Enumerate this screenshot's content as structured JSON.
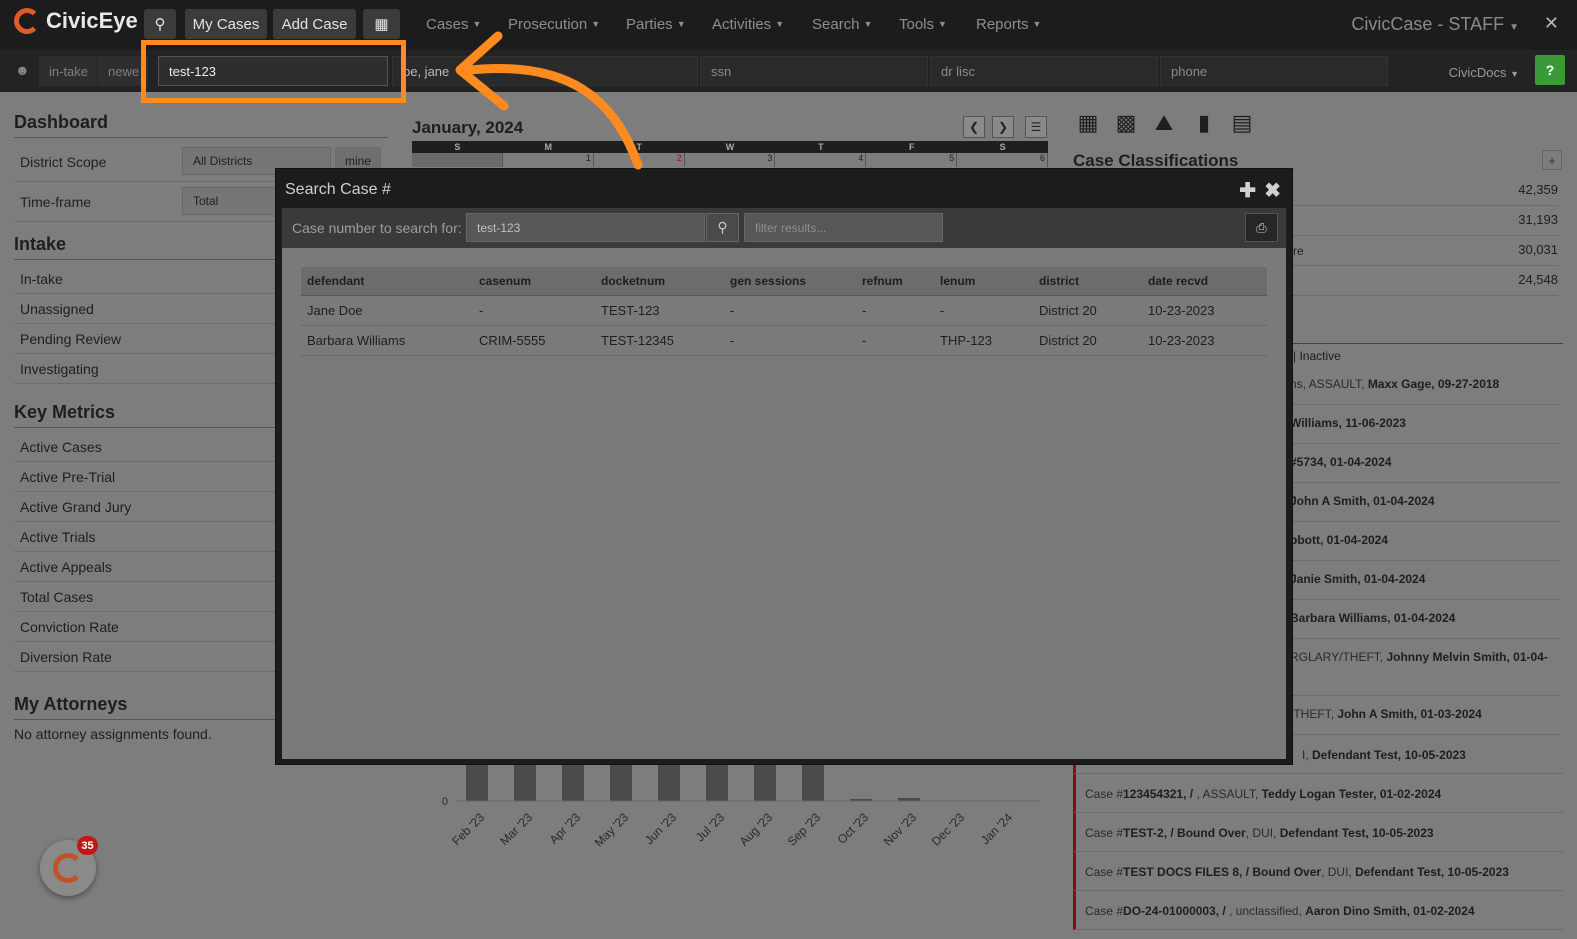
{
  "topbar": {
    "brand": "CivicEye",
    "my_cases": "My Cases",
    "add_case": "Add Case",
    "menus": [
      "Cases",
      "Prosecution",
      "Parties",
      "Activities",
      "Search",
      "Tools",
      "Reports"
    ],
    "app_title": "CivicCase - STAFF",
    "close": "✕"
  },
  "searchrow": {
    "intake": "in-take",
    "newest": "newe",
    "case_value": "test-123",
    "name_value": "pe, jane",
    "ssn_placeholder": "ssn",
    "drlisc_placeholder": "dr lisc",
    "phone_placeholder": "phone",
    "civicdocs": "CivicDocs",
    "help": "?"
  },
  "dashboard": {
    "title": "Dashboard",
    "district_scope_label": "District Scope",
    "district_scope_value": "All Districts",
    "mine": "mine",
    "timeframe_label": "Time-frame",
    "timeframe_value": "Total",
    "intake_title": "Intake",
    "intake_items": [
      "In-take",
      "Unassigned",
      "Pending Review",
      "Investigating"
    ],
    "metrics_title": "Key Metrics",
    "metrics_items": [
      "Active Cases",
      "Active Pre-Trial",
      "Active Grand Jury",
      "Active Trials",
      "Active Appeals",
      "Total Cases",
      "Conviction Rate",
      "Diversion Rate"
    ],
    "attorneys_title": "My Attorneys",
    "attorneys_empty": "No attorney assignments found."
  },
  "calendar": {
    "title": "January, 2024",
    "weekdays": [
      "S",
      "M",
      "T",
      "W",
      "T",
      "F",
      "S"
    ],
    "days": [
      "",
      "1",
      "2",
      "3",
      "4",
      "5",
      "6"
    ]
  },
  "classifications": {
    "title": "Case Classifications",
    "plus": "+",
    "counts": [
      "42,359",
      "31,193",
      "30,031",
      "24,548"
    ],
    "partial_label": "re",
    "inactive": "| Inactive"
  },
  "activity_clipped": [
    {
      "pre": "ns, ASSAULT, ",
      "bold": "Maxx Gage, 09-27-2018"
    },
    {
      "pre": "",
      "bold": "Williams, 11-06-2023"
    },
    {
      "pre": "",
      "bold": "#5734, 01-04-2024"
    },
    {
      "pre": "",
      "bold": "John A Smith, 01-04-2024"
    },
    {
      "pre": "",
      "bold": "bbott, 01-04-2024"
    },
    {
      "pre": "",
      "bold": "Janie Smith, 01-04-2024"
    },
    {
      "pre": "",
      "bold": "Barbara Williams, 01-04-2024"
    },
    {
      "pre": "RGLARY/THEFT, ",
      "bold": "Johnny Melvin Smith, 01-04-"
    },
    {
      "pre": "/THEFT, ",
      "bold": "John A Smith, 01-03-2024"
    },
    {
      "pre": "I, ",
      "bold": "Defendant Test, 10-05-2023"
    }
  ],
  "activity_full": [
    {
      "a": "Case #",
      "b": "123454321, / ",
      "c": ", ASSAULT, ",
      "d": "Teddy Logan Tester, 01-02-2024"
    },
    {
      "a": "Case #",
      "b": "TEST-2, / Bound Over",
      "c": ", DUI, ",
      "d": "Defendant Test, 10-05-2023"
    },
    {
      "a": "Case #",
      "b": "TEST DOCS FILES 8, / Bound Over",
      "c": ", DUI, ",
      "d": "Defendant Test, 10-05-2023"
    },
    {
      "a": "Case #",
      "b": "DO-24-01000003, / ",
      "c": ", unclassified, ",
      "d": "Aaron Dino Smith, 01-02-2024"
    }
  ],
  "chart_data": {
    "type": "bar",
    "categories": [
      "Feb '23",
      "Mar '23",
      "Apr '23",
      "May '23",
      "Jun '23",
      "Jul '23",
      "Aug '23",
      "Sep '23",
      "Oct '23",
      "Nov '23",
      "Dec '23",
      "Jan '24"
    ],
    "zero_label": "0"
  },
  "fab": {
    "badge": "35"
  },
  "modal": {
    "title": "Search Case #",
    "plus": "✚",
    "close": "✖",
    "label": "Case number to search for:",
    "input_value": "test-123",
    "filter_placeholder": "filter results...",
    "columns": [
      "defendant",
      "casenum",
      "docketnum",
      "gen sessions",
      "refnum",
      "lenum",
      "district",
      "date recvd"
    ],
    "rows": [
      [
        "Jane Doe",
        "-",
        "TEST-123",
        "-",
        "-",
        "-",
        "District 20",
        "10-23-2023"
      ],
      [
        "Barbara Williams",
        "CRIM-5555",
        "TEST-12345",
        "-",
        "-",
        "THP-123",
        "District 20",
        "10-23-2023"
      ]
    ]
  },
  "colors": {
    "highlight": "#ff8a1f",
    "accent_red": "#8a0d0d",
    "help_green": "#3a9a3a"
  }
}
